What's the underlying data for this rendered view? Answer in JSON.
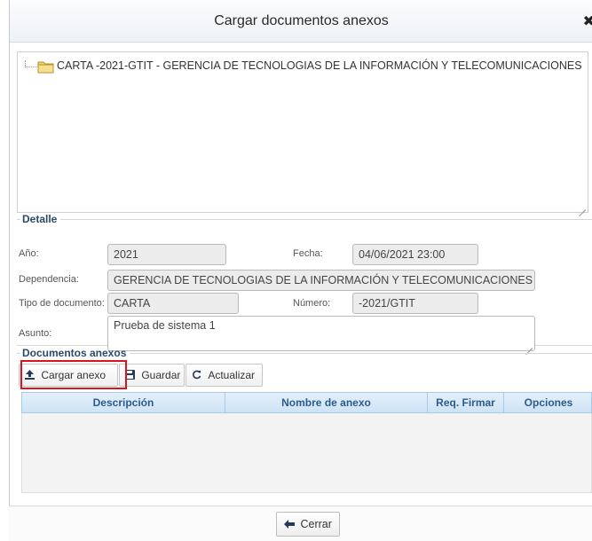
{
  "dialog": {
    "title": "Cargar documentos anexos",
    "close_glyph": "✖"
  },
  "tree": {
    "node_label": "CARTA -2021-GTIT - GERENCIA DE TECNOLOGIAS DE LA INFORMACIÓN Y TELECOMUNICACIONES",
    "icon": "folder-icon"
  },
  "detalle": {
    "legend": "Detalle",
    "anio_label": "Año:",
    "anio_value": "2021",
    "fecha_label": "Fecha:",
    "fecha_value": "04/06/2021 23:00",
    "dependencia_label": "Dependencia:",
    "dependencia_value": "GERENCIA DE TECNOLOGIAS DE LA INFORMACIÓN Y TELECOMUNICACIONES",
    "tipo_label": "Tipo de documento:",
    "tipo_value": "CARTA",
    "numero_label": "Número:",
    "numero_value": "-2021/GTIT",
    "asunto_label": "Asunto:",
    "asunto_value": "Prueba de sistema 1"
  },
  "anexos": {
    "legend": "Documentos anexos",
    "toolbar": {
      "cargar_label": "Cargar anexo",
      "guardar_label": "Guardar",
      "actualizar_label": "Actualizar"
    },
    "columns": [
      "Descripción",
      "Nombre de anexo",
      "Req. Firmar",
      "Opciones"
    ]
  },
  "footer": {
    "cerrar_label": "Cerrar"
  },
  "colors": {
    "highlight": "#d9141f",
    "header_text": "#2d5b8a",
    "icon": "#23395d"
  }
}
